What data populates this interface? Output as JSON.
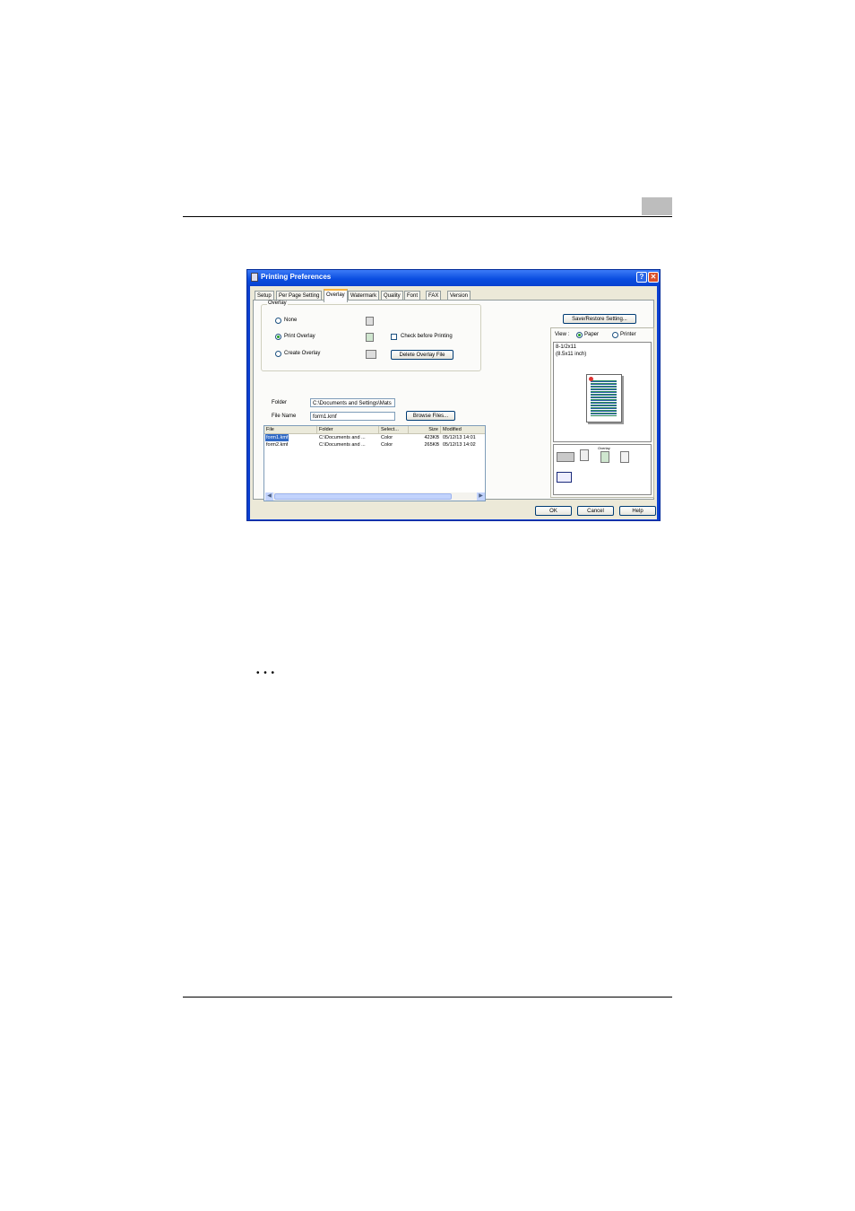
{
  "dialog": {
    "title": "Printing Preferences",
    "help_glyph": "?",
    "close_glyph": "✕",
    "tabs": [
      "Setup",
      "Per Page Setting",
      "Overlay",
      "Watermark",
      "Quality",
      "Font",
      "FAX",
      "Version"
    ],
    "active_tab": "Overlay",
    "overlay_group": {
      "label": "Overlay",
      "options": [
        "None",
        "Print Overlay",
        "Create Overlay"
      ],
      "selected": "Print Overlay",
      "check_before_printing": "Check before Printing",
      "delete_button": "Delete Overlay File"
    },
    "folder_label": "Folder",
    "folder_value": "C:\\Documents and Settings\\Mats",
    "file_name_label": "File Name",
    "file_name_value": "form1.kmf",
    "browse_button": "Browse Files...",
    "file_list": {
      "columns": [
        "File",
        "Folder",
        "Select...",
        "Size",
        "Modified"
      ],
      "rows": [
        [
          "form1.kmf",
          "C:\\Documents and ...",
          "Color",
          "423KB",
          "05/12/13 14:01"
        ],
        [
          "form2.kmf",
          "C:\\Documents and ...",
          "Color",
          "265KB",
          "05/12/13 14:02"
        ]
      ]
    },
    "save_restore_button": "Save/Restore Setting...",
    "view_label": "View :",
    "view_paper": "Paper",
    "view_printer": "Printer",
    "paper_size_line1": "8-1/2x11",
    "paper_size_line2": "(8.5x11 inch)",
    "overlay_caption": "Overlay",
    "ok_button": "OK",
    "cancel_button": "Cancel",
    "help_button": "Help"
  },
  "page": {
    "ellipsis": "• • •"
  }
}
